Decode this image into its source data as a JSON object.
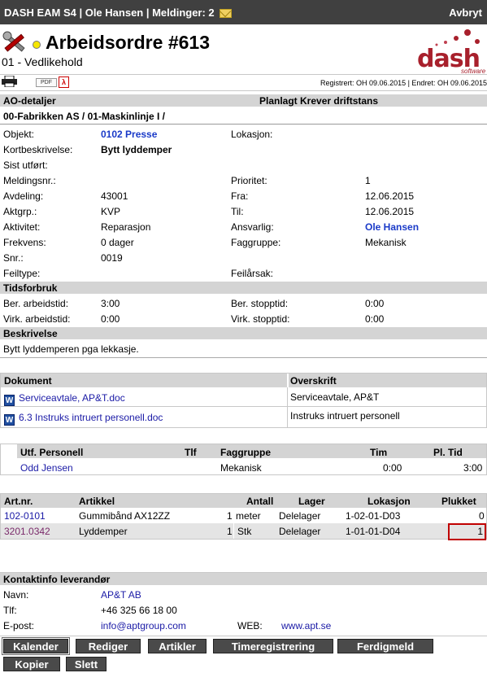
{
  "topbar": {
    "title": "DASH EAM S4 | Ole Hansen | Meldinger: 2",
    "cancel": "Avbryt"
  },
  "header": {
    "title": "Arbeidsordre #613",
    "subtitle": "01 - Vedlikehold",
    "pdf_label": "PDF",
    "registered": "Registrert: OH 09.06.2015 | Endret: OH 09.06.2015",
    "logo_text": "dash",
    "logo_sub": "software"
  },
  "ao": {
    "section_title": "AO-detaljer",
    "section_note": "Planlagt Krever driftstans",
    "location_path": "00-Fabrikken AS / 01-Maskinlinje I /"
  },
  "fields": {
    "objekt_label": "Objekt:",
    "objekt_value": "0102 Presse",
    "lokasjon_label": "Lokasjon:",
    "kort_label": "Kortbeskrivelse:",
    "kort_value": "Bytt lyddemper",
    "sist_label": "Sist utført:",
    "meldingsnr_label": "Meldingsnr.:",
    "prioritet_label": "Prioritet:",
    "prioritet_value": "1",
    "avdeling_label": "Avdeling:",
    "avdeling_value": "43001",
    "fra_label": "Fra:",
    "fra_value": "12.06.2015",
    "aktgrp_label": "Aktgrp.:",
    "aktgrp_value": "KVP",
    "til_label": "Til:",
    "til_value": "12.06.2015",
    "aktivitet_label": "Aktivitet:",
    "aktivitet_value": "Reparasjon",
    "ansvarlig_label": "Ansvarlig:",
    "ansvarlig_value": "Ole Hansen",
    "frekvens_label": "Frekvens:",
    "frekvens_value": "0 dager",
    "faggruppe_label": "Faggruppe:",
    "faggruppe_value": "Mekanisk",
    "snr_label": "Snr.:",
    "snr_value": "0019",
    "feiltype_label": "Feiltype:",
    "feilarsak_label": "Feilårsak:"
  },
  "tid": {
    "section_title": "Tidsforbruk",
    "ber_arb_label": "Ber. arbeidstid:",
    "ber_arb_value": "3:00",
    "ber_stopp_label": "Ber. stopptid:",
    "ber_stopp_value": "0:00",
    "virk_arb_label": "Virk. arbeidstid:",
    "virk_arb_value": "0:00",
    "virk_stopp_label": "Virk. stopptid:",
    "virk_stopp_value": "0:00"
  },
  "beskrivelse": {
    "section_title": "Beskrivelse",
    "text": "Bytt lyddemperen pga lekkasje."
  },
  "documents": {
    "col_doc": "Dokument",
    "col_title": "Overskrift",
    "rows": [
      {
        "name": "Serviceavtale, AP&T.doc",
        "title": "Serviceavtale, AP&T"
      },
      {
        "name": "6.3 Instruks intruert personell.doc",
        "title": "Instruks intruert personell"
      }
    ]
  },
  "personnel": {
    "headers": [
      "Utf. Personell",
      "Tlf",
      "Faggruppe",
      "Tim",
      "Pl. Tid"
    ],
    "rows": [
      {
        "name": "Odd Jensen",
        "tlf": "",
        "faggruppe": "Mekanisk",
        "tim": "0:00",
        "pltid": "3:00"
      }
    ]
  },
  "articles": {
    "headers": [
      "Art.nr.",
      "Artikkel",
      "Antall",
      "Lager",
      "Lokasjon",
      "Plukket"
    ],
    "rows": [
      {
        "artnr": "102-0101",
        "artikkel": "Gummibånd AX12ZZ",
        "antall": "1",
        "enhet": "meter",
        "lager": "Delelager",
        "lokasjon": "1-02-01-D03",
        "plukket": "0"
      },
      {
        "artnr": "3201.0342",
        "artikkel": "Lyddemper",
        "antall": "1",
        "enhet": "Stk",
        "lager": "Delelager",
        "lokasjon": "1-01-01-D04",
        "plukket": "1"
      }
    ]
  },
  "supplier": {
    "section_title": "Kontaktinfo leverandør",
    "navn_label": "Navn:",
    "navn_value": "AP&T AB",
    "tlf_label": "Tlf:",
    "tlf_value": "+46 325 66 18 00",
    "epost_label": "E-post:",
    "epost_value": "info@aptgroup.com",
    "web_label": "WEB:",
    "web_value": "www.apt.se"
  },
  "buttons": {
    "kalender": "Kalender",
    "rediger": "Rediger",
    "artikler": "Artikler",
    "timeregistrering": "Timeregistrering",
    "ferdigmeld": "Ferdigmeld",
    "kopier": "Kopier",
    "slett": "Slett"
  },
  "colors": {
    "topbar": "#404040",
    "section": "#d4d4d4",
    "link": "#1a1aa6",
    "accent_blue": "#1a3ac8",
    "logo_red": "#a8202c",
    "status_dot": "#f5e600"
  }
}
